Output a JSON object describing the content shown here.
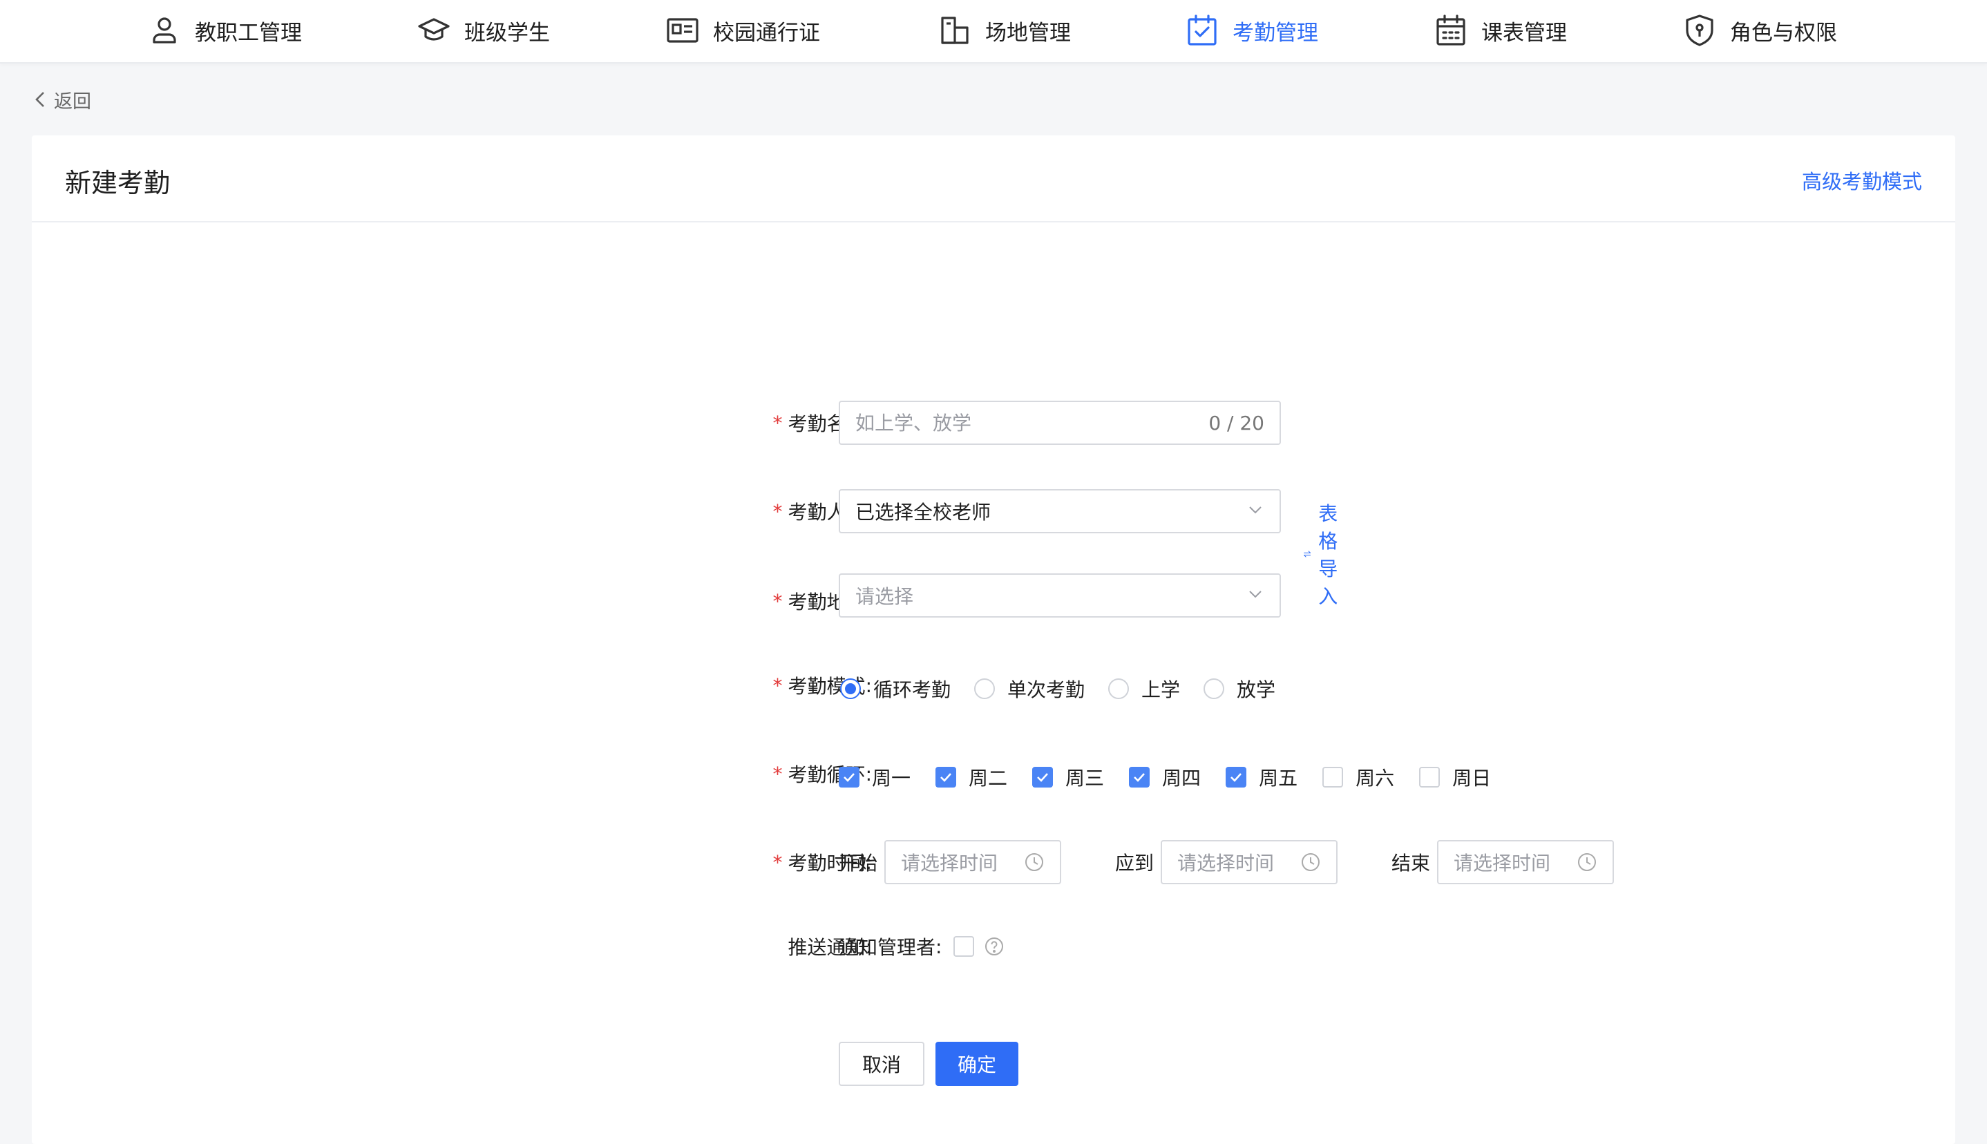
{
  "nav": {
    "items": [
      {
        "label": "教职工管理",
        "icon": "user-icon"
      },
      {
        "label": "班级学生",
        "icon": "graduation-cap-icon"
      },
      {
        "label": "校园通行证",
        "icon": "id-card-icon"
      },
      {
        "label": "场地管理",
        "icon": "building-icon"
      },
      {
        "label": "考勤管理",
        "icon": "calendar-check-icon",
        "active": true
      },
      {
        "label": "课表管理",
        "icon": "calendar-icon"
      },
      {
        "label": "角色与权限",
        "icon": "shield-icon"
      }
    ],
    "active_color": "#2f6df6"
  },
  "back": {
    "label": "返回"
  },
  "card": {
    "title": "新建考勤",
    "advanced_link": "高级考勤模式"
  },
  "form": {
    "name": {
      "label": "考勤名称",
      "placeholder": "如上学、放学",
      "counter": "0 / 20"
    },
    "people": {
      "label": "考勤人员",
      "value": "已选择全校老师",
      "import_link": "表格导入"
    },
    "location": {
      "label": "考勤地点",
      "placeholder": "请选择"
    },
    "mode": {
      "label": "考勤模式",
      "options": [
        "循环考勤",
        "单次考勤",
        "上学",
        "放学"
      ],
      "selected": "循环考勤"
    },
    "cycle": {
      "label": "考勤循环",
      "days": [
        {
          "label": "周一",
          "checked": true
        },
        {
          "label": "周二",
          "checked": true
        },
        {
          "label": "周三",
          "checked": true
        },
        {
          "label": "周四",
          "checked": true
        },
        {
          "label": "周五",
          "checked": true
        },
        {
          "label": "周六",
          "checked": false
        },
        {
          "label": "周日",
          "checked": false
        }
      ]
    },
    "time": {
      "label": "考勤时间",
      "start_label": "开始",
      "due_label": "应到",
      "end_label": "结束",
      "placeholder": "请选择时间"
    },
    "notify": {
      "label": "推送通知",
      "sub_label": "通知管理者",
      "checked": false
    },
    "buttons": {
      "cancel": "取消",
      "confirm": "确定"
    }
  },
  "colors": {
    "primary": "#2f6df6",
    "required": "#e23b3b",
    "checkbox": "#4a84f5"
  }
}
